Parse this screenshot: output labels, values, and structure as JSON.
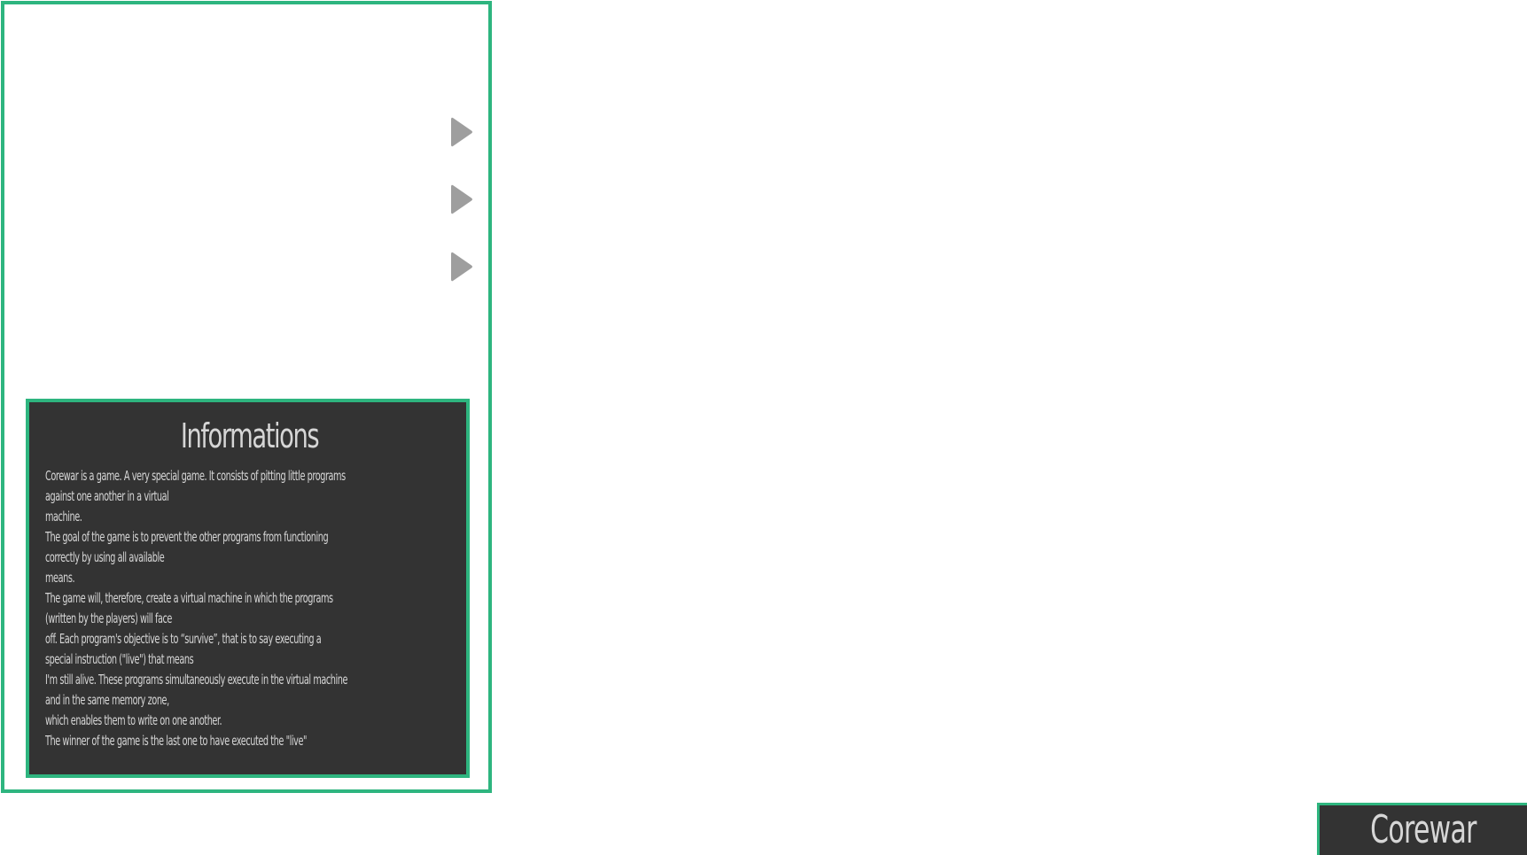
{
  "colors": {
    "accent": "#2eb57f",
    "panel_bg": "#333333",
    "text": "#d6d6d6",
    "play_icon": "#9e9e9e",
    "page_bg": "#ffffff"
  },
  "play_buttons": [
    {
      "icon": "play-icon"
    },
    {
      "icon": "play-icon"
    },
    {
      "icon": "play-icon"
    }
  ],
  "info": {
    "title": "Informations",
    "lines": [
      "Corewar is a game. A very special game. It consists of pitting little programs",
      "against one another in a virtual",
      "machine.",
      "The goal of the game is to prevent the other programs from functioning",
      "correctly by using all available",
      "means.",
      "The game will, therefore, create a virtual machine in which the programs",
      "(written by the players) will face",
      "off. Each program's objective is to “survive”, that is to say executing a",
      "special instruction (\"live\") that means",
      "I'm still alive. These programs simultaneously execute in the virtual machine",
      "and in the same memory zone,",
      "which enables them to write on one another.",
      "The winner of the game is the last one to have executed the \"live\""
    ]
  },
  "brand": {
    "label": "Corewar"
  }
}
